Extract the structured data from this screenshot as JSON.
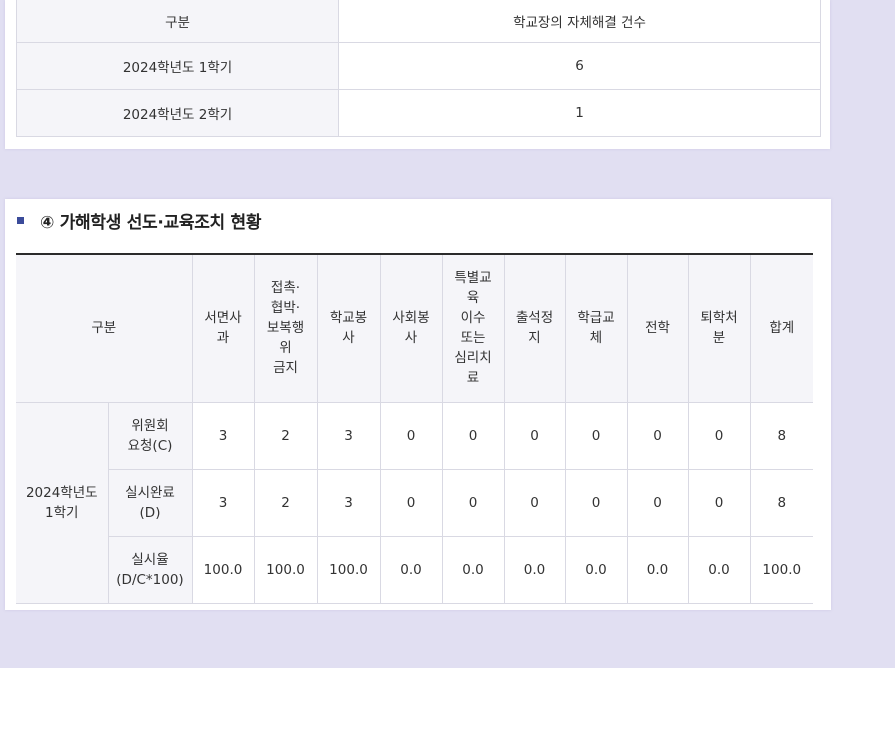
{
  "table1": {
    "header": [
      "구분",
      "학교장의 자체해결 건수"
    ],
    "rows": [
      [
        "2024학년도 1학기",
        "6"
      ],
      [
        "2024학년도 2학기",
        "1"
      ]
    ]
  },
  "section4": {
    "title": "④ 가해학생 선도·교육조치 현황",
    "header": {
      "group": "구분",
      "cols": [
        "서면사\n과",
        "접촉·\n협박·\n보복행\n위\n금지",
        "학교봉\n사",
        "사회봉\n사",
        "특별교\n육\n이수\n또는\n심리치\n료",
        "출석정\n지",
        "학급교\n체",
        "전학",
        "퇴학처\n분",
        "합계"
      ]
    },
    "term": "2024학년도\n1학기",
    "rows": [
      {
        "label": "위원회\n요청(C)",
        "values": [
          "3",
          "2",
          "3",
          "0",
          "0",
          "0",
          "0",
          "0",
          "0",
          "8"
        ]
      },
      {
        "label": "실시완료\n(D)",
        "values": [
          "3",
          "2",
          "3",
          "0",
          "0",
          "0",
          "0",
          "0",
          "0",
          "8"
        ]
      },
      {
        "label": "실시율\n(D/C*100)",
        "values": [
          "100.0",
          "100.0",
          "100.0",
          "0.0",
          "0.0",
          "0.0",
          "0.0",
          "0.0",
          "0.0",
          "100.0"
        ]
      }
    ]
  },
  "colors": {
    "band": "#e1dff2",
    "bullet": "#3b4b9a",
    "header_bg": "#f5f5f9",
    "border": "#d9d9e3"
  }
}
